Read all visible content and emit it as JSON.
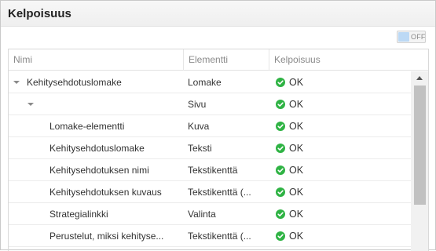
{
  "panel": {
    "title": "Kelpoisuus"
  },
  "toggle": {
    "label": "OFF"
  },
  "columns": [
    "Nimi",
    "Elementti",
    "Kelpoisuus"
  ],
  "rows": [
    {
      "name": "Kehitysehdotuslomake",
      "element": "Lomake",
      "status": "OK",
      "indent": 0,
      "expandable": true
    },
    {
      "name": "",
      "element": "Sivu",
      "status": "OK",
      "indent": 1,
      "expandable": true
    },
    {
      "name": "Lomake-elementti",
      "element": "Kuva",
      "status": "OK",
      "indent": 2,
      "expandable": false
    },
    {
      "name": "Kehitysehdotuslomake",
      "element": "Teksti",
      "status": "OK",
      "indent": 2,
      "expandable": false
    },
    {
      "name": "Kehitysehdotuksen nimi",
      "element": "Tekstikenttä",
      "status": "OK",
      "indent": 2,
      "expandable": false
    },
    {
      "name": "Kehitysehdotuksen kuvaus",
      "element": "Tekstikenttä (...",
      "status": "OK",
      "indent": 2,
      "expandable": false
    },
    {
      "name": "Strategialinkki",
      "element": "Valinta",
      "status": "OK",
      "indent": 2,
      "expandable": false
    },
    {
      "name": "Perustelut, miksi kehityse...",
      "element": "Tekstikenttä (...",
      "status": "OK",
      "indent": 2,
      "expandable": false
    }
  ],
  "colors": {
    "ok": "#2fb344",
    "toggle_off": "#bcd9f5"
  },
  "icons": {
    "status": "check-circle-icon",
    "expand": "caret-down-icon"
  }
}
